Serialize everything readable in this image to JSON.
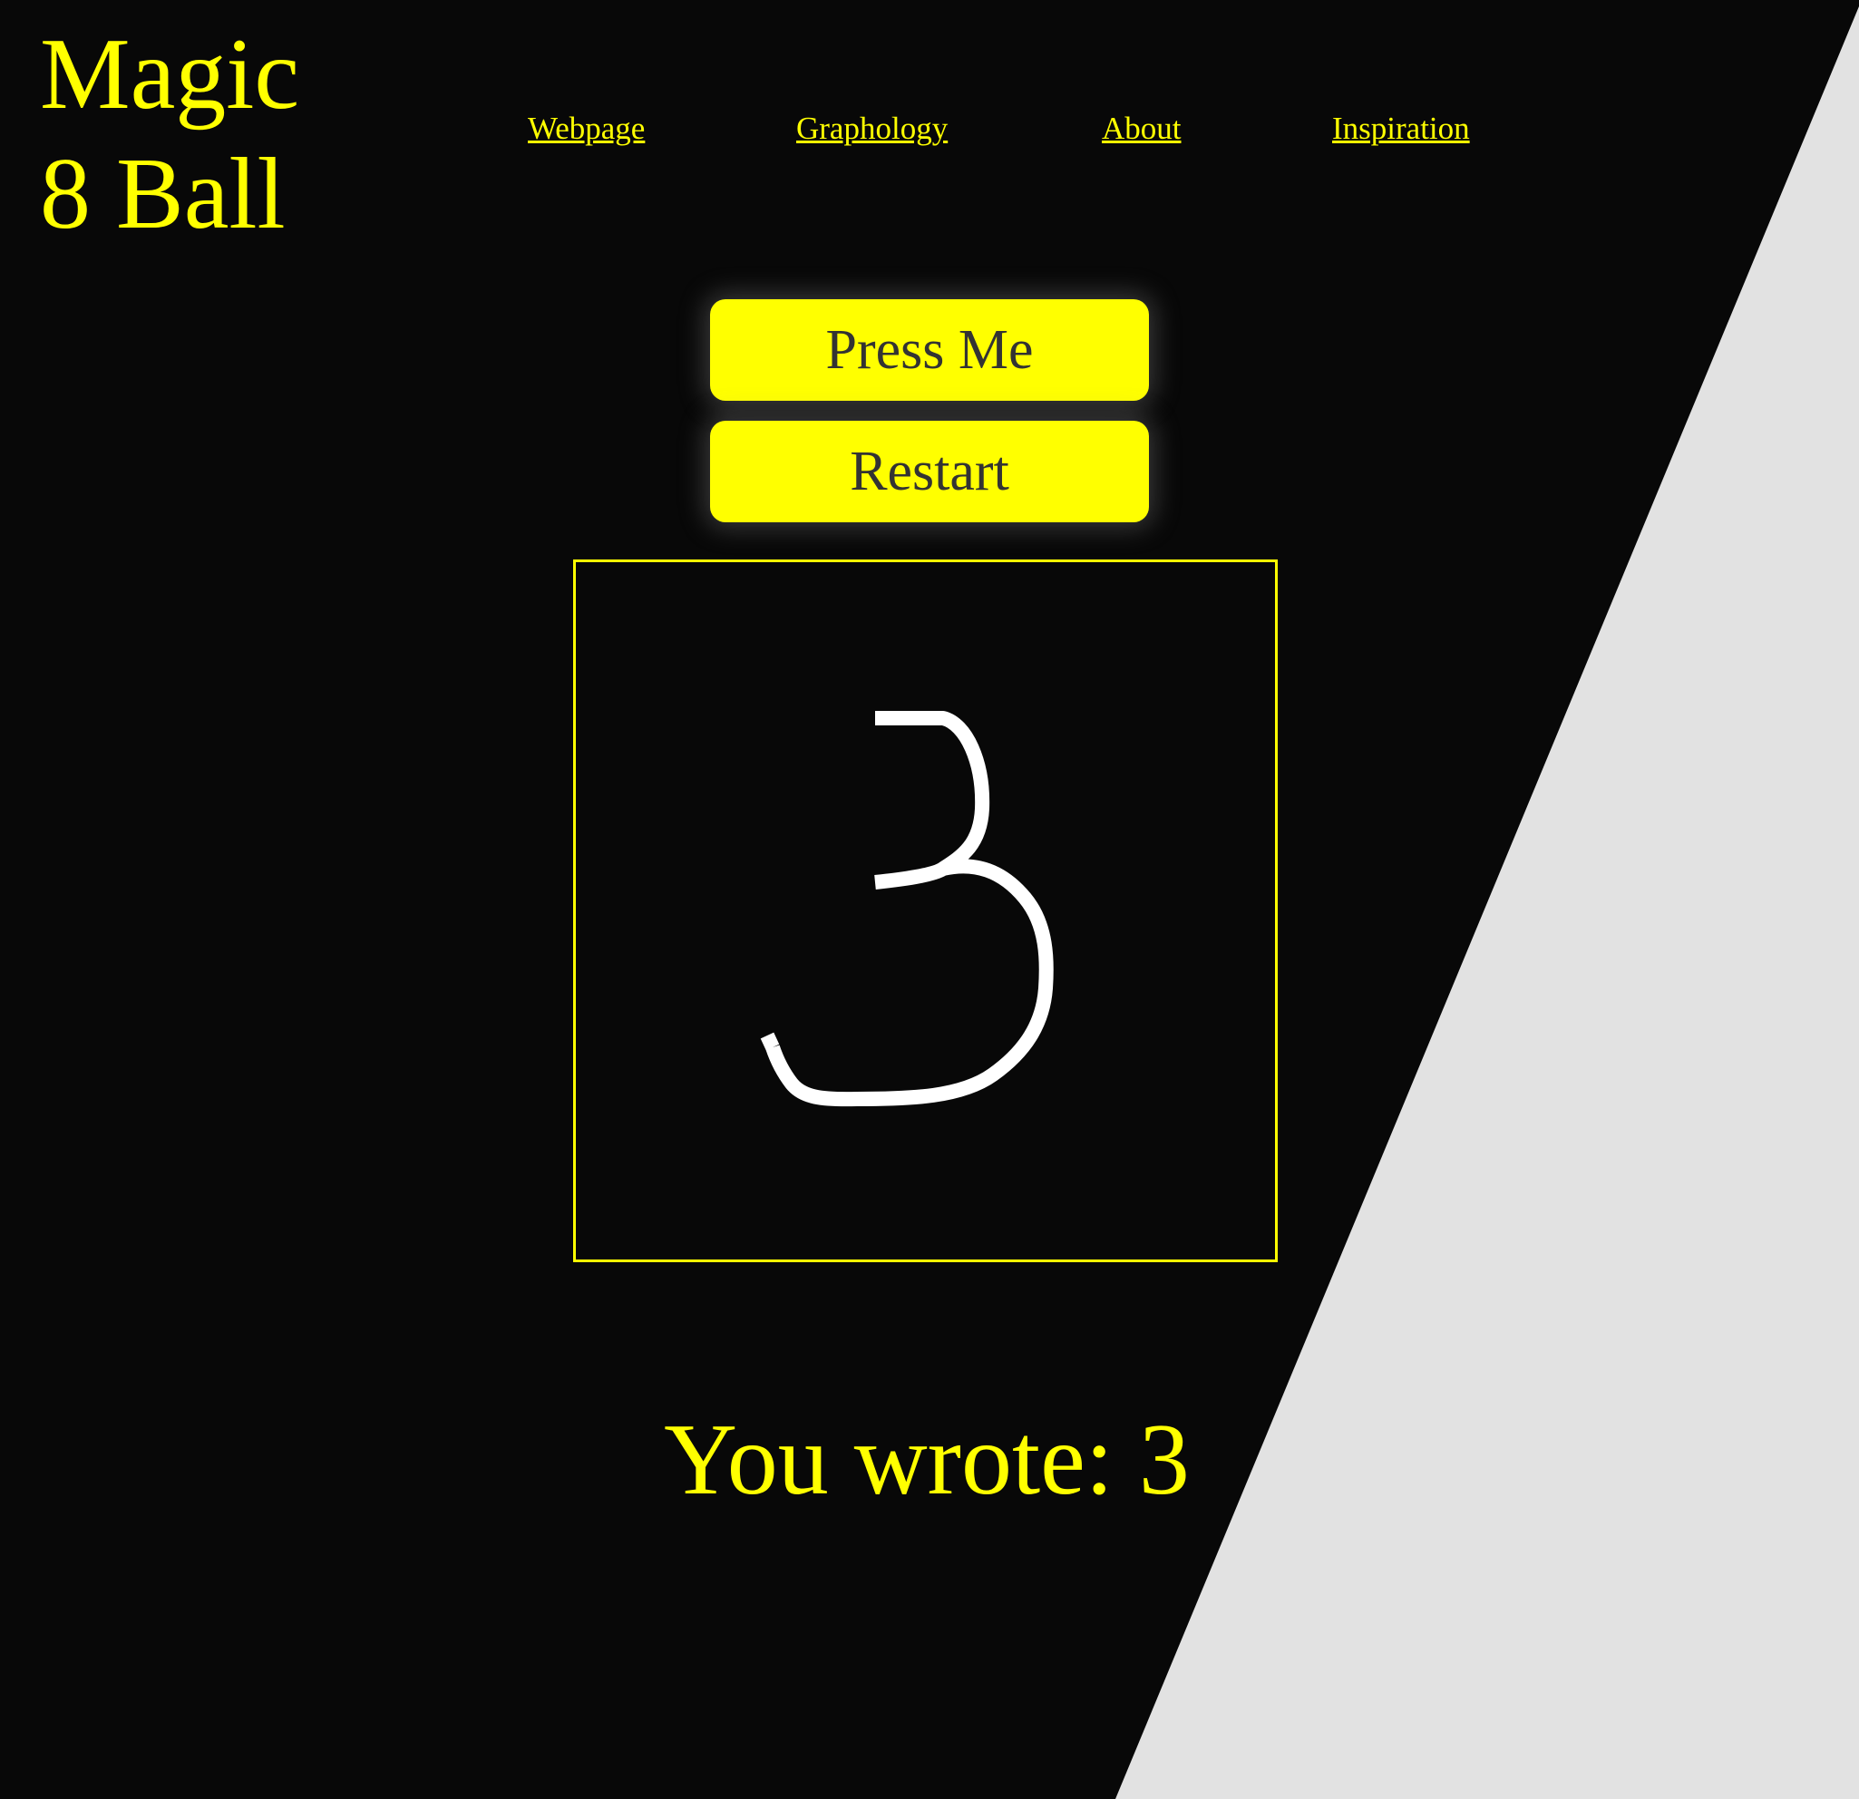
{
  "site": {
    "title_line1": "Magic",
    "title_line2": "8 Ball"
  },
  "nav": {
    "items": [
      {
        "label": "Webpage"
      },
      {
        "label": "Graphology"
      },
      {
        "label": "About"
      },
      {
        "label": "Inspiration"
      }
    ]
  },
  "controls": {
    "press_label": "Press Me",
    "restart_label": "Restart"
  },
  "canvas": {
    "drawn_glyph": "3",
    "stroke_color": "#ffffff",
    "border_color": "#ffff00"
  },
  "result": {
    "prefix": "You wrote: ",
    "value": "3"
  },
  "colors": {
    "accent": "#ffff00",
    "background_dark": "#080808",
    "background_light": "#e2e2e2",
    "button_text": "#333333"
  }
}
